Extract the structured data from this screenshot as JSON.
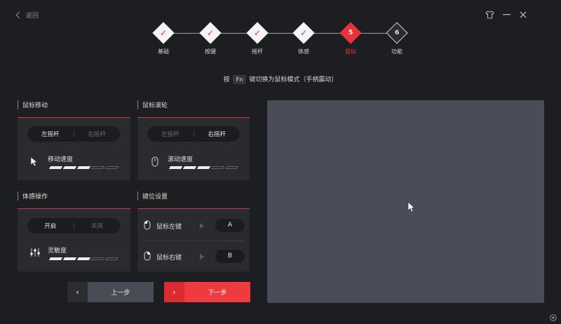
{
  "header": {
    "back_label": "返回"
  },
  "steps": [
    {
      "label": "基础",
      "status": "done",
      "mark": "✓"
    },
    {
      "label": "按键",
      "status": "done",
      "mark": "✓"
    },
    {
      "label": "摇杆",
      "status": "done",
      "mark": "✓"
    },
    {
      "label": "体感",
      "status": "done",
      "mark": "✓"
    },
    {
      "label": "鼠标",
      "status": "active",
      "mark": "5"
    },
    {
      "label": "功能",
      "status": "pending",
      "mark": "6"
    }
  ],
  "hint": {
    "prefix": "按",
    "key": "Fn",
    "suffix": "键切换为鼠标模式（手柄震动）"
  },
  "mouse_move": {
    "title": "鼠标移动",
    "options": [
      "左摇杆",
      "右摇杆"
    ],
    "selected": 0,
    "speed_label": "移动速度",
    "speed_level": 3,
    "speed_max": 5
  },
  "mouse_wheel": {
    "title": "鼠标滚轮",
    "options": [
      "左摇杆",
      "右摇杆"
    ],
    "selected": 1,
    "speed_label": "滚动速度",
    "speed_level": 3,
    "speed_max": 5
  },
  "motion": {
    "title": "体感操作",
    "options": [
      "开启",
      "关闭"
    ],
    "selected": 0,
    "sensitivity_label": "灵敏度",
    "sensitivity_level": 3,
    "sensitivity_max": 5
  },
  "key_settings": {
    "title": "键位设置",
    "rows": [
      {
        "label": "鼠标左键",
        "value": "A"
      },
      {
        "label": "鼠标右键",
        "value": "B"
      }
    ]
  },
  "nav": {
    "prev_label": "上一步",
    "next_label": "下一步"
  },
  "colors": {
    "accent": "#e7333a",
    "background": "#1d1e21",
    "panel": "#2a2b2f",
    "touchpad": "#4a4d59"
  }
}
